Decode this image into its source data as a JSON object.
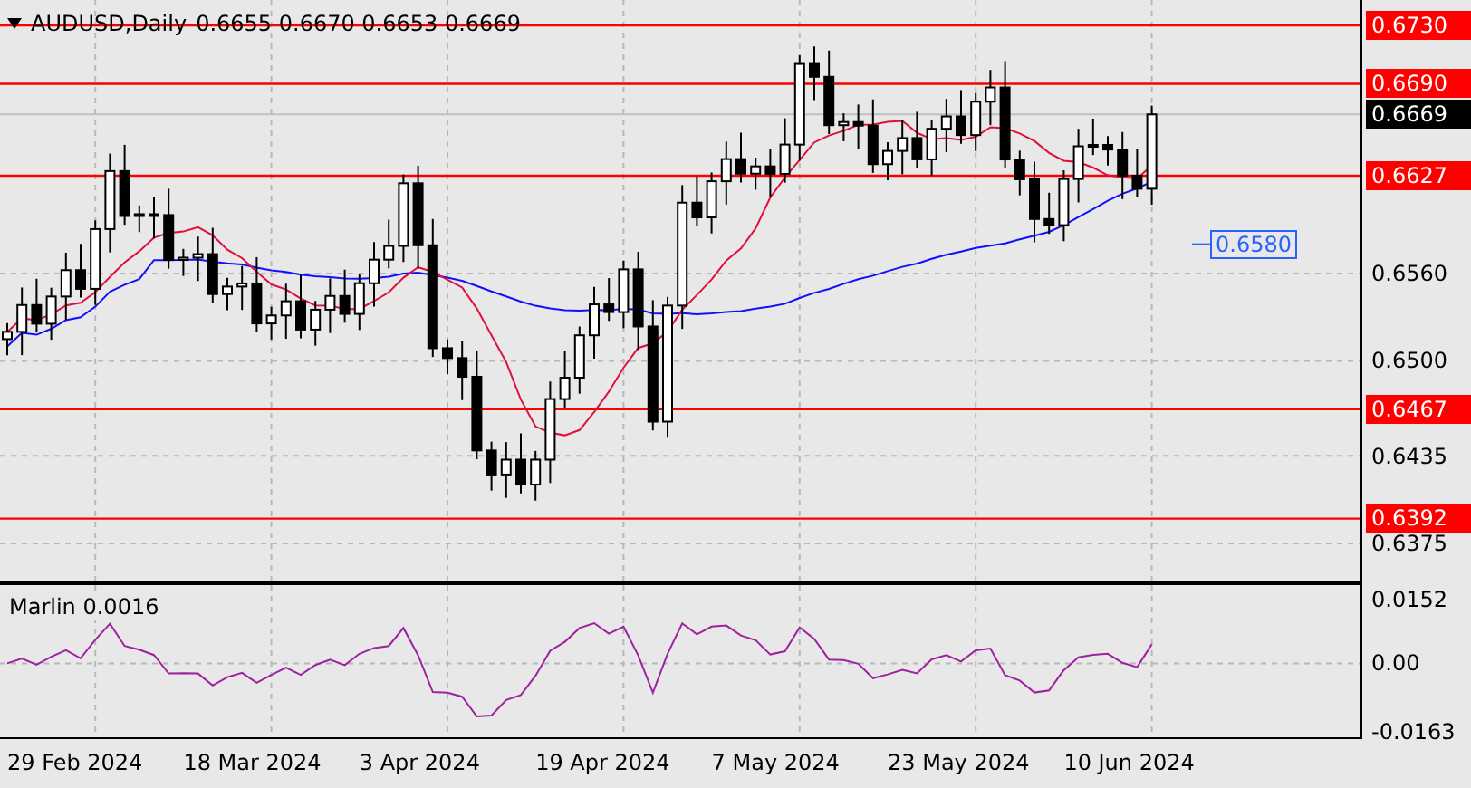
{
  "header": {
    "symbol": "AUDUSD,Daily",
    "ohlc": "0.6655 0.6670 0.6653 0.6669"
  },
  "levels": [
    {
      "label": "0.6730"
    },
    {
      "label": "0.6690"
    },
    {
      "label": "0.6627"
    },
    {
      "label": "0.6467"
    },
    {
      "label": "0.6392"
    }
  ],
  "price_ticks": [
    "0.6560",
    "0.6500",
    "0.6435",
    "0.6375"
  ],
  "current_price": "0.6669",
  "annotation": "0.6580",
  "indicator": {
    "name": "Marlin 0.0016",
    "ticks": [
      "0.0152",
      "0.00",
      "-0.0163"
    ]
  },
  "dates": [
    "29 Feb 2024",
    "18 Mar 2024",
    "3 Apr 2024",
    "19 Apr 2024",
    "7 May 2024",
    "23 May 2024",
    "10 Jun 2024"
  ]
}
